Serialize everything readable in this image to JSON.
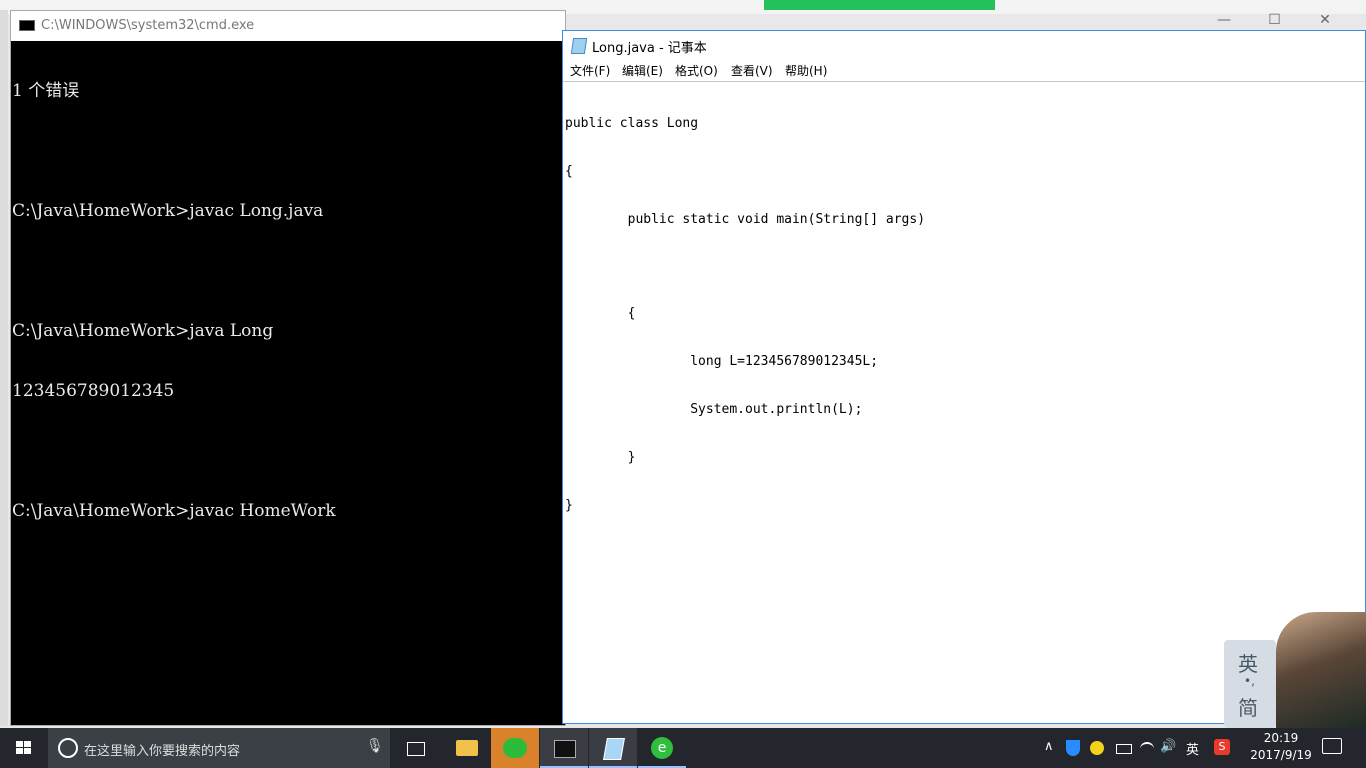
{
  "cmd": {
    "title": "C:\\WINDOWS\\system32\\cmd.exe",
    "lines": [
      "1 个错误",
      "",
      "C:\\Java\\HomeWork>javac Long.java",
      "",
      "C:\\Java\\HomeWork>java Long",
      "123456789012345",
      "",
      "C:\\Java\\HomeWork>javac HomeWork"
    ]
  },
  "notepad": {
    "title": "Long.java - 记事本",
    "menu": [
      "文件(F)",
      "编辑(E)",
      "格式(O)",
      "查看(V)",
      "帮助(H)"
    ],
    "code_lines": [
      "public class Long",
      "{",
      "        public static void main(String[] args)",
      "",
      "        {",
      "                long L=123456789012345L;",
      "                System.out.println(L);",
      "        }",
      "}"
    ]
  },
  "window_controls": [
    "—",
    "☐",
    "✕"
  ],
  "ime": {
    "top": "英",
    "dot": "•,",
    "bottom": "简"
  },
  "taskbar": {
    "search_placeholder": "在这里输入你要搜索的内容",
    "mic_icon": "🎙",
    "browser_glyph": "e",
    "tray": {
      "up_arrow": "∧",
      "volume": "🔊",
      "language": "英",
      "sogou": "S"
    },
    "time": "20:19",
    "date": "2017/9/19"
  },
  "colors": {
    "taskbar_bg": "#23262c",
    "accent": "#3b8ee7",
    "console_bg": "#000000"
  }
}
